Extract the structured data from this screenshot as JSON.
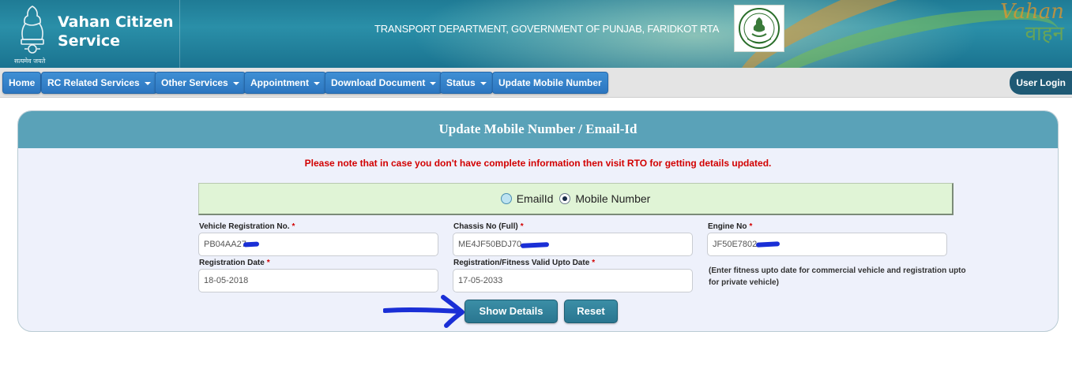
{
  "header": {
    "brand_title": "Vahan Citizen Service",
    "emblem_caption": "सत्यमेव जयते",
    "department": "TRANSPORT DEPARTMENT, GOVERNMENT OF PUNJAB, FARIDKOT RTA",
    "logo_text_en": "Vahan",
    "logo_text_hi": "वाहन",
    "seal_caption": "GOVT. PUNJAB"
  },
  "nav": {
    "items": [
      {
        "label": "Home",
        "dropdown": false
      },
      {
        "label": "RC Related Services",
        "dropdown": true
      },
      {
        "label": "Other Services",
        "dropdown": true
      },
      {
        "label": "Appointment",
        "dropdown": true
      },
      {
        "label": "Download Document",
        "dropdown": true
      },
      {
        "label": "Status",
        "dropdown": true
      },
      {
        "label": "Update Mobile Number",
        "dropdown": false
      }
    ],
    "user_login": "User Login"
  },
  "form": {
    "title": "Update Mobile Number / Email-Id",
    "notice": "Please note that in case you don't have complete information then visit RTO for getting details updated.",
    "radio": {
      "email_label": "EmailId",
      "mobile_label": "Mobile Number",
      "selected": "Mobile Number"
    },
    "fields": {
      "reg_no": {
        "label": "Vehicle Registration No.",
        "value": "PB04AA27"
      },
      "chassis": {
        "label": "Chassis No (Full)",
        "value": "ME4JF50BDJ70"
      },
      "engine": {
        "label": "Engine No",
        "value": "JF50E7802"
      },
      "reg_date": {
        "label": "Registration Date",
        "value": "18-05-2018"
      },
      "valid_upto": {
        "label": "Registration/Fitness Valid Upto Date",
        "value": "17-05-2033"
      }
    },
    "required_mark": "*",
    "hint": "(Enter fitness upto date for commercial vehicle and registration upto for private vehicle)",
    "show_details": "Show Details",
    "reset": "Reset"
  },
  "colors": {
    "nav_button": "#2f7cc6",
    "panel_header": "#5aa2b8",
    "notice_red": "#d20000",
    "action_button": "#2f7e97",
    "annotation_blue": "#1a2fd6"
  }
}
